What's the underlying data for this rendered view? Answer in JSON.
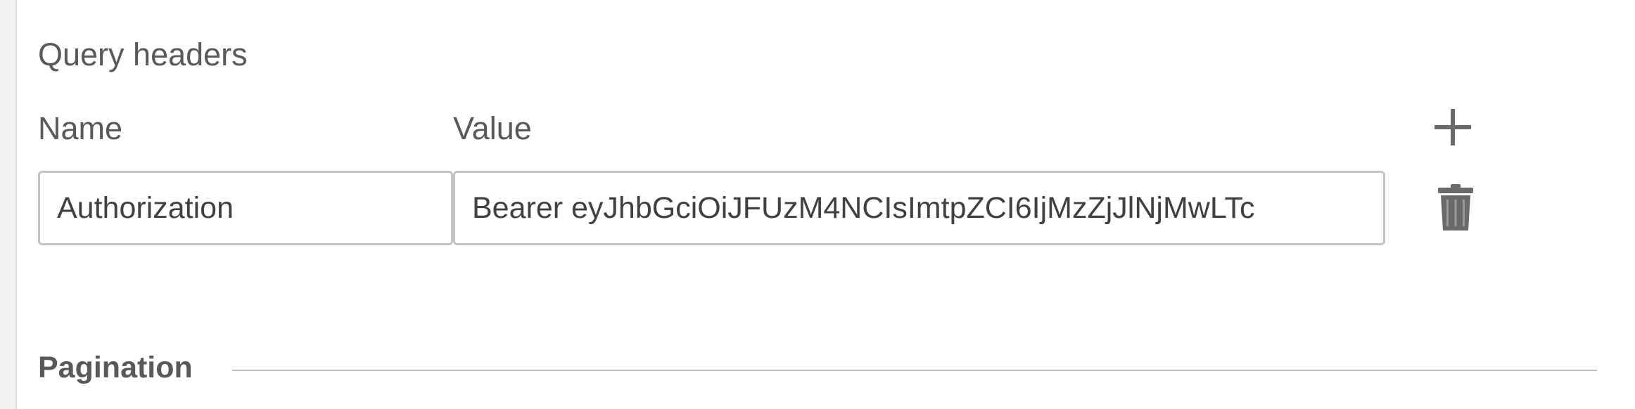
{
  "query_headers": {
    "title": "Query headers",
    "name_label": "Name",
    "value_label": "Value",
    "add_icon": "plus-icon",
    "rows": [
      {
        "name": "Authorization",
        "value": "Bearer eyJhbGciOiJFUzM4NCIsImtpZCI6IjMzZjJlNjMwLTc",
        "delete_icon": "trash-icon"
      }
    ]
  },
  "pagination": {
    "title": "Pagination"
  },
  "colors": {
    "text": "#595959",
    "field_border": "#c4c4c4",
    "icon": "#6a6a6a",
    "divider": "#bdbdbd"
  }
}
